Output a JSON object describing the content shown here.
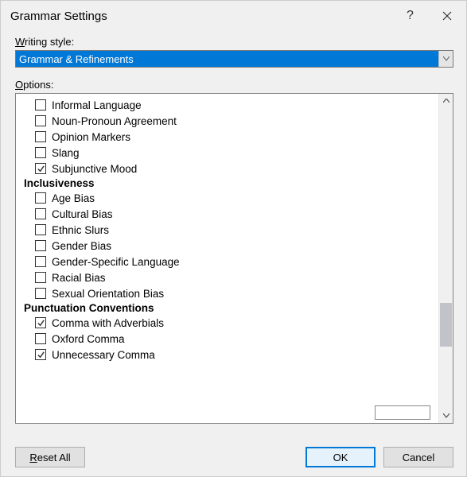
{
  "title": "Grammar Settings",
  "titlebar": {
    "help_glyph": "?",
    "close_glyph": "✕"
  },
  "writing_style_label": "Writing style:",
  "writing_style_value": "Grammar & Refinements",
  "options_label": "Options:",
  "groups": [
    {
      "title": null,
      "items": [
        {
          "label": "Informal Language",
          "checked": false
        },
        {
          "label": "Noun-Pronoun Agreement",
          "checked": false
        },
        {
          "label": "Opinion Markers",
          "checked": false
        },
        {
          "label": "Slang",
          "checked": false
        },
        {
          "label": "Subjunctive Mood",
          "checked": true
        }
      ]
    },
    {
      "title": "Inclusiveness",
      "items": [
        {
          "label": "Age Bias",
          "checked": false
        },
        {
          "label": "Cultural Bias",
          "checked": false
        },
        {
          "label": "Ethnic Slurs",
          "checked": false
        },
        {
          "label": "Gender Bias",
          "checked": false
        },
        {
          "label": "Gender-Specific Language",
          "checked": false
        },
        {
          "label": "Racial Bias",
          "checked": false
        },
        {
          "label": "Sexual Orientation Bias",
          "checked": false
        }
      ]
    },
    {
      "title": "Punctuation Conventions",
      "items": [
        {
          "label": "Comma with Adverbials",
          "checked": true
        },
        {
          "label": "Oxford Comma",
          "checked": false
        },
        {
          "label": "Unnecessary Comma",
          "checked": true
        }
      ]
    }
  ],
  "buttons": {
    "reset": "Reset All",
    "ok": "OK",
    "cancel": "Cancel"
  }
}
